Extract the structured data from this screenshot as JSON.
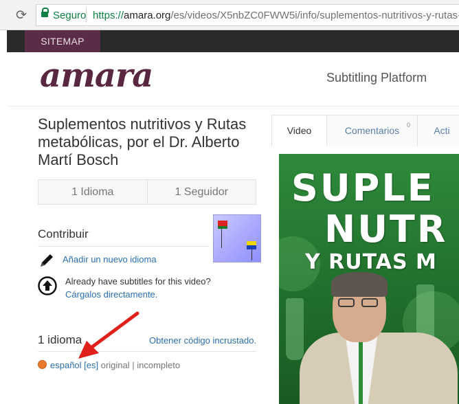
{
  "browser": {
    "secure_label": "Seguro",
    "url_scheme": "https://",
    "url_host": "amara.org",
    "url_path": "/es/videos/X5nbZC0FWW5i/info/suplementos-nutritivos-y-rutas-"
  },
  "topbar": {
    "sitemap_label": "SITEMAP"
  },
  "header": {
    "logo_text": "amara",
    "tagline": "Subtitling Platform"
  },
  "video_info": {
    "title": "Suplementos nutritivos y Rutas metabólicas, por el Dr. Alberto Martí Bosch",
    "languages_stat": "1 Idioma",
    "followers_stat": "1 Seguidor"
  },
  "contribute": {
    "heading": "Contribuir",
    "add_language": "Añadir un nuevo idioma",
    "have_subtitles": "Already have subtitles for this video?",
    "upload_link": "Cárgalos directamente."
  },
  "languages": {
    "heading": "1 idioma",
    "embed_link": "Obtener código incrustado.",
    "items": [
      {
        "name": "español [es]",
        "tags": "original | incompleto",
        "status_color": "#e87a2c"
      }
    ]
  },
  "tabs": {
    "video": "Video",
    "comments": "Comentarios",
    "comments_count": "0",
    "activity": "Acti"
  },
  "video_thumbnail": {
    "line1": "SUPLE",
    "line2": "NUTR",
    "line3": "Y RUTAS M"
  },
  "colors": {
    "accent": "#5a2740",
    "link": "#2a6fb0",
    "annotation_arrow": "#e0201a"
  }
}
